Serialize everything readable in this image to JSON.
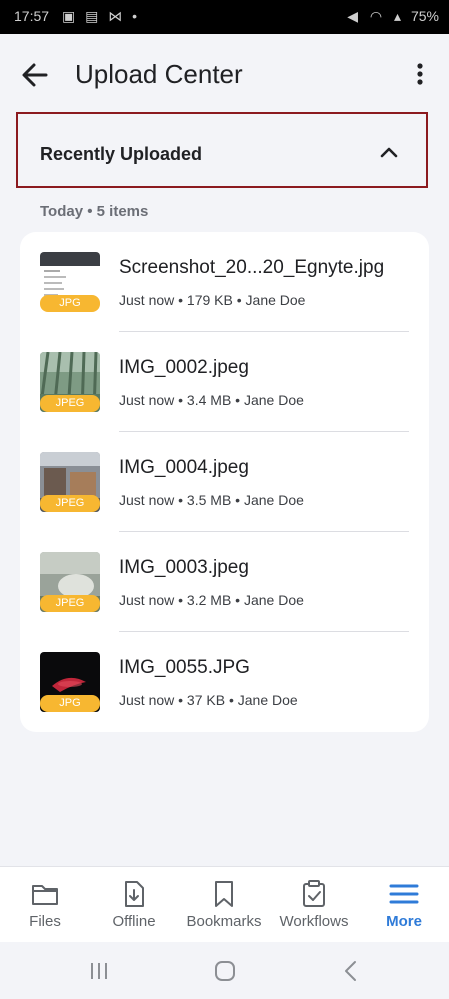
{
  "status_bar": {
    "time": "17:57",
    "battery": "75%"
  },
  "app_bar": {
    "title": "Upload Center",
    "back_icon": "arrow-back-icon",
    "menu_icon": "more-vert-icon"
  },
  "section": {
    "title": "Recently Uploaded",
    "toggle_icon": "chevron-up-icon"
  },
  "group": {
    "label": "Today • 5 items"
  },
  "files": [
    {
      "name": "Screenshot_20...20_Egnyte.jpg",
      "meta": "Just now • 179 KB • Jane Doe",
      "badge": "JPG"
    },
    {
      "name": "IMG_0002.jpeg",
      "meta": "Just now • 3.4 MB • Jane Doe",
      "badge": "JPEG"
    },
    {
      "name": "IMG_0004.jpeg",
      "meta": "Just now • 3.5 MB • Jane Doe",
      "badge": "JPEG"
    },
    {
      "name": "IMG_0003.jpeg",
      "meta": "Just now • 3.2 MB • Jane Doe",
      "badge": "JPEG"
    },
    {
      "name": "IMG_0055.JPG",
      "meta": "Just now • 37 KB • Jane Doe",
      "badge": "JPG"
    }
  ],
  "bottom_nav": [
    {
      "label": "Files",
      "icon": "folder-icon",
      "active": false
    },
    {
      "label": "Offline",
      "icon": "download-file-icon",
      "active": false
    },
    {
      "label": "Bookmarks",
      "icon": "bookmark-icon",
      "active": false
    },
    {
      "label": "Workflows",
      "icon": "clipboard-check-icon",
      "active": false
    },
    {
      "label": "More",
      "icon": "menu-lines-icon",
      "active": true
    }
  ],
  "colors": {
    "accent": "#2f7bd8",
    "highlight_border": "#8b1a1f",
    "badge": "#f7b731",
    "background": "#f3f4f8"
  }
}
